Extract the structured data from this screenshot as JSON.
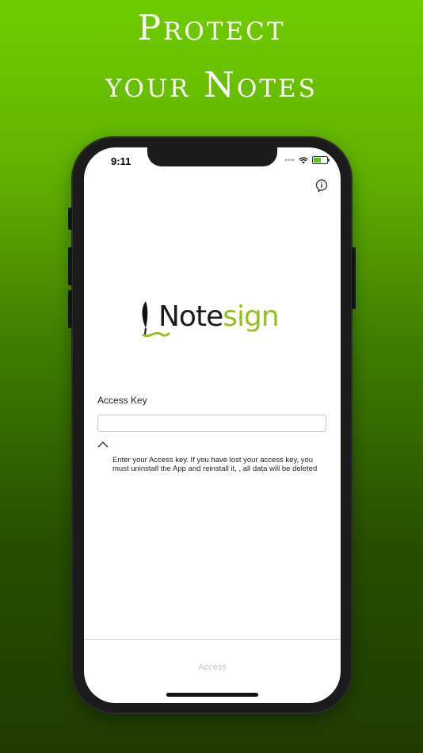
{
  "headline": {
    "line1": "Protect",
    "line2": "your Notes"
  },
  "status_bar": {
    "time": "9:11"
  },
  "logo": {
    "part1": "Note",
    "part2": "sign"
  },
  "form": {
    "label": "Access Key",
    "value": "",
    "placeholder": "",
    "hint": "Enter your Access key. If you have lost your access key, you must uninstall the App and reinstall it, , all data will be deleted",
    "submit_label": "Access"
  },
  "colors": {
    "accent_green": "#8fc21a",
    "background_top": "#6fcc00",
    "background_bottom": "#1f3c00"
  }
}
